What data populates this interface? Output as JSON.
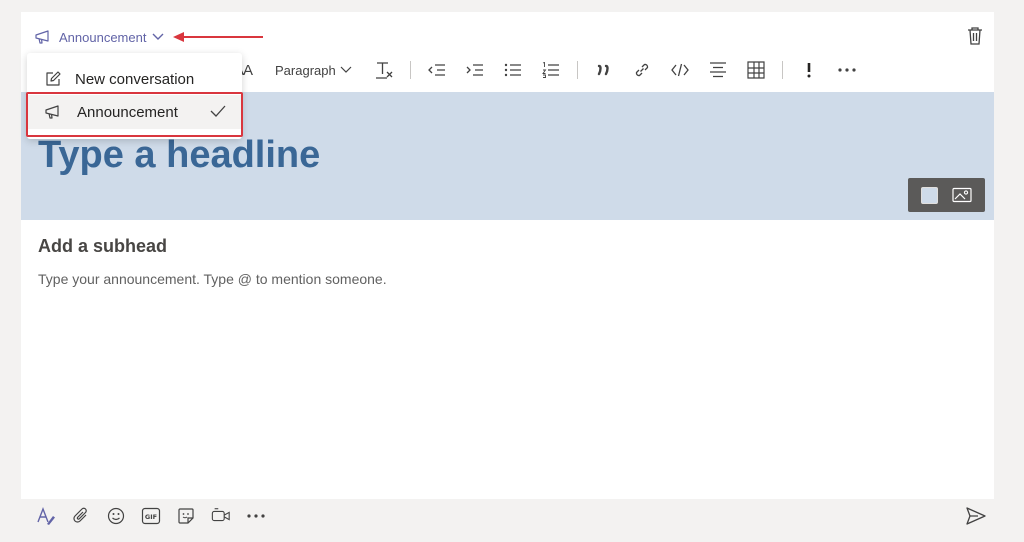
{
  "composer": {
    "post_type_label": "Announcement",
    "headline_placeholder": "Type a headline",
    "subhead_placeholder": "Add a subhead",
    "body_placeholder": "Type your announcement. Type @ to mention someone."
  },
  "post_type_menu": {
    "items": [
      {
        "label": "New conversation",
        "icon": "edit-icon",
        "selected": false
      },
      {
        "label": "Announcement",
        "icon": "megaphone-icon",
        "selected": true
      }
    ]
  },
  "toolbar": {
    "font_size_glyph": "AA",
    "paragraph_label": "Paragraph"
  },
  "colors": {
    "accent": "#6264a7",
    "banner": "#cfdbe9",
    "headline": "#3a6796",
    "highlight": "#d9363e"
  },
  "icons": {
    "toolbar": [
      "font-color-icon",
      "font-size-icon",
      "paragraph-dropdown",
      "clear-formatting-icon",
      "decrease-indent-icon",
      "increase-indent-icon",
      "bulleted-list-icon",
      "numbered-list-icon",
      "quote-icon",
      "link-icon",
      "code-icon",
      "align-icon",
      "table-icon",
      "important-icon",
      "more-options-icon"
    ],
    "bottom": [
      "format-icon",
      "attach-icon",
      "emoji-icon",
      "gif-icon",
      "sticker-icon",
      "meet-now-icon",
      "more-icon",
      "send-icon"
    ]
  }
}
